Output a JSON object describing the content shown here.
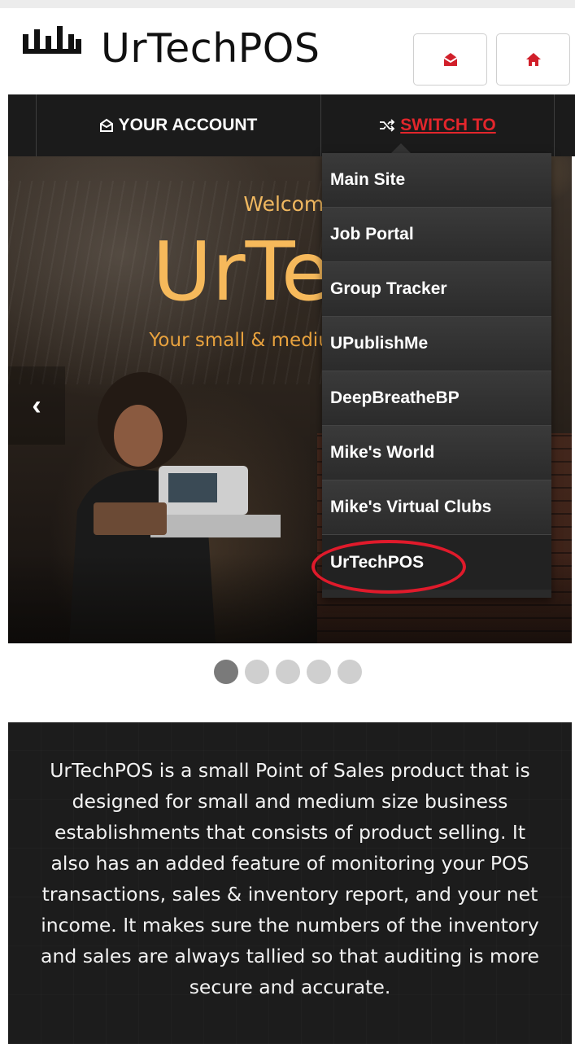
{
  "header": {
    "logo_text": "UrTechPOS",
    "buttons": [
      {
        "icon": "mail-icon"
      },
      {
        "icon": "home-icon"
      }
    ]
  },
  "nav": {
    "account_label": "YOUR ACCOUNT",
    "switch_label": "SWITCH TO"
  },
  "dropdown": {
    "items": [
      "Main Site",
      "Job Portal",
      "Group Tracker",
      "UPublishMe",
      "DeepBreatheBP",
      "Mike's World",
      "Mike's Virtual Clubs",
      "UrTechPOS"
    ]
  },
  "hero": {
    "welcome": "Welcome",
    "title": "UrTech",
    "tagline": "Your small & medium solution",
    "prev_arrow": "‹"
  },
  "carousel": {
    "slide_count": 5,
    "active_index": 0
  },
  "description": {
    "text": "UrTechPOS is a small Point of Sales product that is designed for small and medium size business establishments that consists of product selling. It also has an added feature of monitoring your POS transactions, sales & inventory report, and your net income. It makes sure the numbers of the inventory and sales are always tallied so that auditing is more secure and accurate."
  },
  "colors": {
    "accent_red": "#e3262c",
    "hero_gold": "#f6b95b",
    "nav_bg": "#1b1b1b"
  }
}
